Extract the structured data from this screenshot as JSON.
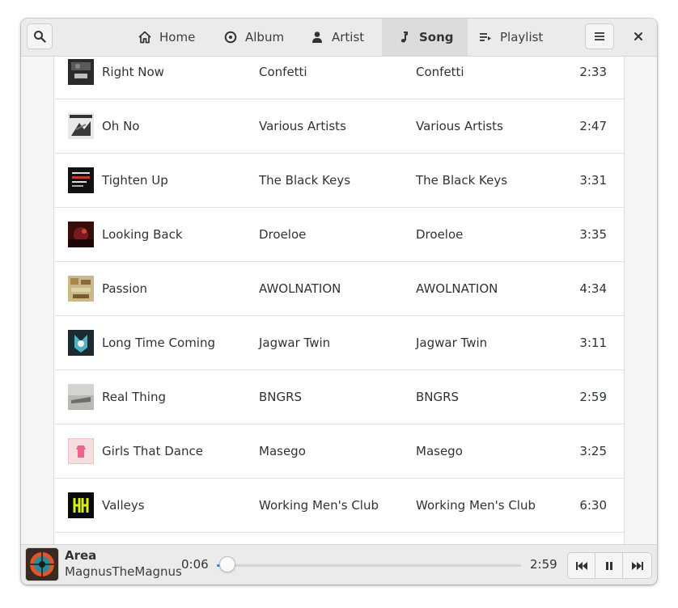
{
  "header": {
    "tabs": [
      {
        "label": "Home",
        "icon": "home-icon",
        "active": false
      },
      {
        "label": "Album",
        "icon": "disc-icon",
        "active": false
      },
      {
        "label": "Artist",
        "icon": "person-icon",
        "active": false
      },
      {
        "label": "Song",
        "icon": "music-note-icon",
        "active": true
      },
      {
        "label": "Playlist",
        "icon": "playlist-icon",
        "active": false
      }
    ]
  },
  "songs": [
    {
      "title": "Right Now",
      "artist": "Confetti",
      "album": "Confetti",
      "duration": "2:33"
    },
    {
      "title": "Oh No",
      "artist": "Various Artists",
      "album": "Various Artists",
      "duration": "2:47"
    },
    {
      "title": "Tighten Up",
      "artist": "The Black Keys",
      "album": "The Black Keys",
      "duration": "3:31"
    },
    {
      "title": "Looking Back",
      "artist": "Droeloe",
      "album": "Droeloe",
      "duration": "3:35"
    },
    {
      "title": "Passion",
      "artist": "AWOLNATION",
      "album": "AWOLNATION",
      "duration": "4:34"
    },
    {
      "title": "Long Time Coming",
      "artist": "Jagwar Twin",
      "album": "Jagwar Twin",
      "duration": "3:11"
    },
    {
      "title": "Real Thing",
      "artist": "BNGRS",
      "album": "BNGRS",
      "duration": "2:59"
    },
    {
      "title": "Girls That Dance",
      "artist": "Masego",
      "album": "Masego",
      "duration": "3:25"
    },
    {
      "title": "Valleys",
      "artist": "Working Men's Club",
      "album": "Working Men's Club",
      "duration": "6:30"
    }
  ],
  "player": {
    "title": "Area",
    "artist": "MagnusTheMagnus",
    "elapsed": "0:06",
    "total": "2:59",
    "progress": 0.034
  },
  "colors": {
    "accent": "#3584e4",
    "header_bg": "#ebebea",
    "window_bg": "#f6f5f4"
  }
}
